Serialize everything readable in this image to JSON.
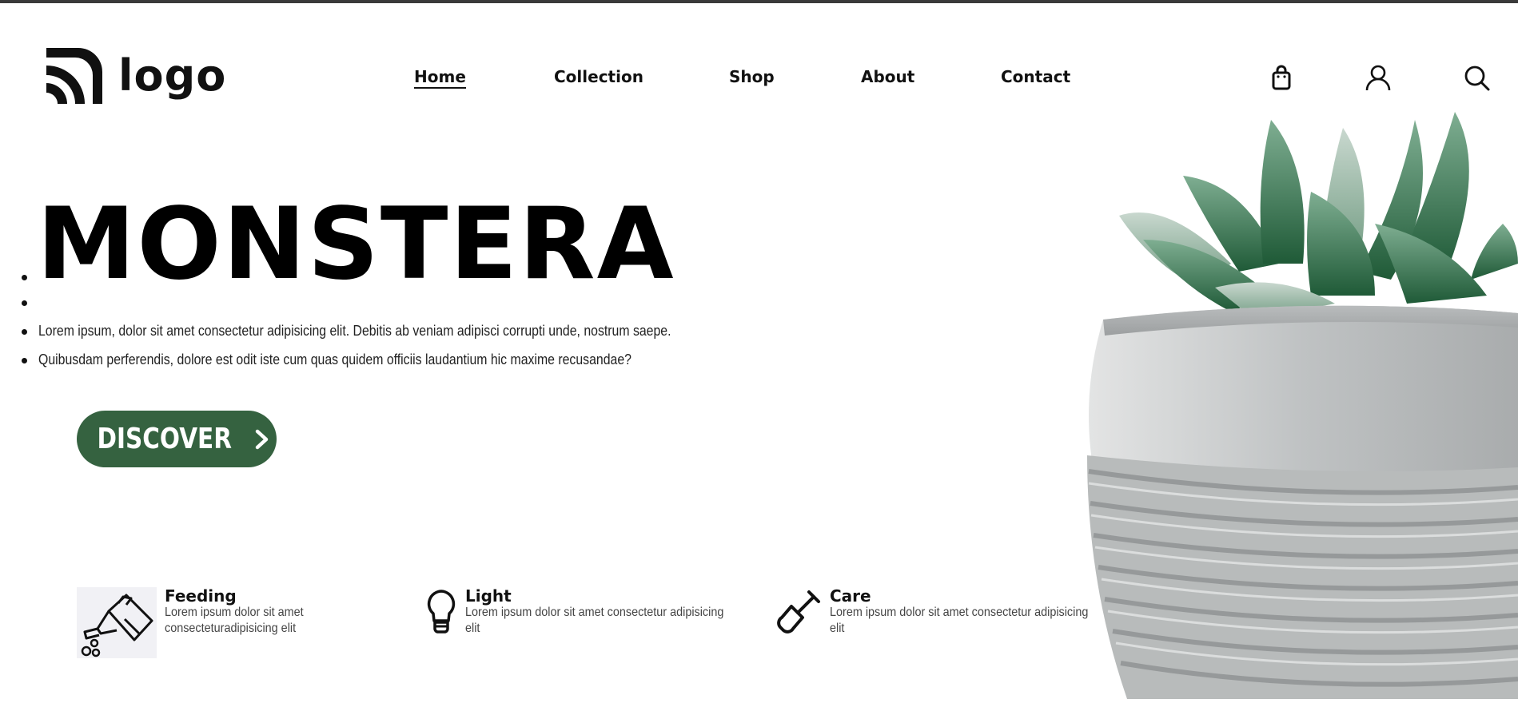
{
  "brand": {
    "logo_text": "logo",
    "icon": "rss-logo-icon"
  },
  "nav": {
    "items": [
      {
        "label": "Home",
        "active": true
      },
      {
        "label": "Collection",
        "active": false
      },
      {
        "label": "Shop",
        "active": false
      },
      {
        "label": "About",
        "active": false
      },
      {
        "label": "Contact",
        "active": false
      }
    ]
  },
  "header_icons": [
    "shopping-bag-icon",
    "user-icon",
    "search-icon"
  ],
  "hero": {
    "title": "MONSTERA",
    "lines": [
      "Lorem ipsum, dolor sit amet consectetur adipisicing elit. Debitis ab veniam adipisci corrupti unde, nostrum saepe.",
      "Quibusdam perferendis, dolore est odit iste cum quas quidem officiis laudantium hic maxime recusandae?"
    ],
    "cta_label": "DISCOVER"
  },
  "features": [
    {
      "title": "Feeding",
      "desc_1": "Lorem ipsum dolor sit amet",
      "desc_2": "consecteturadipisicing elit",
      "icon": "watering-can-icon"
    },
    {
      "title": "Light",
      "desc_1": "Lorem ipsum dolor sit amet consectetur adipisicing",
      "desc_2": "elit",
      "icon": "light-bulb-icon"
    },
    {
      "title": "Care",
      "desc_1": "Lorem ipsum dolor sit amet consectetur adipisicing",
      "desc_2": "elit",
      "icon": "shovel-icon"
    }
  ],
  "colors": {
    "accent": "#356240",
    "text": "#111111",
    "topbar": "#3a3a3a"
  }
}
